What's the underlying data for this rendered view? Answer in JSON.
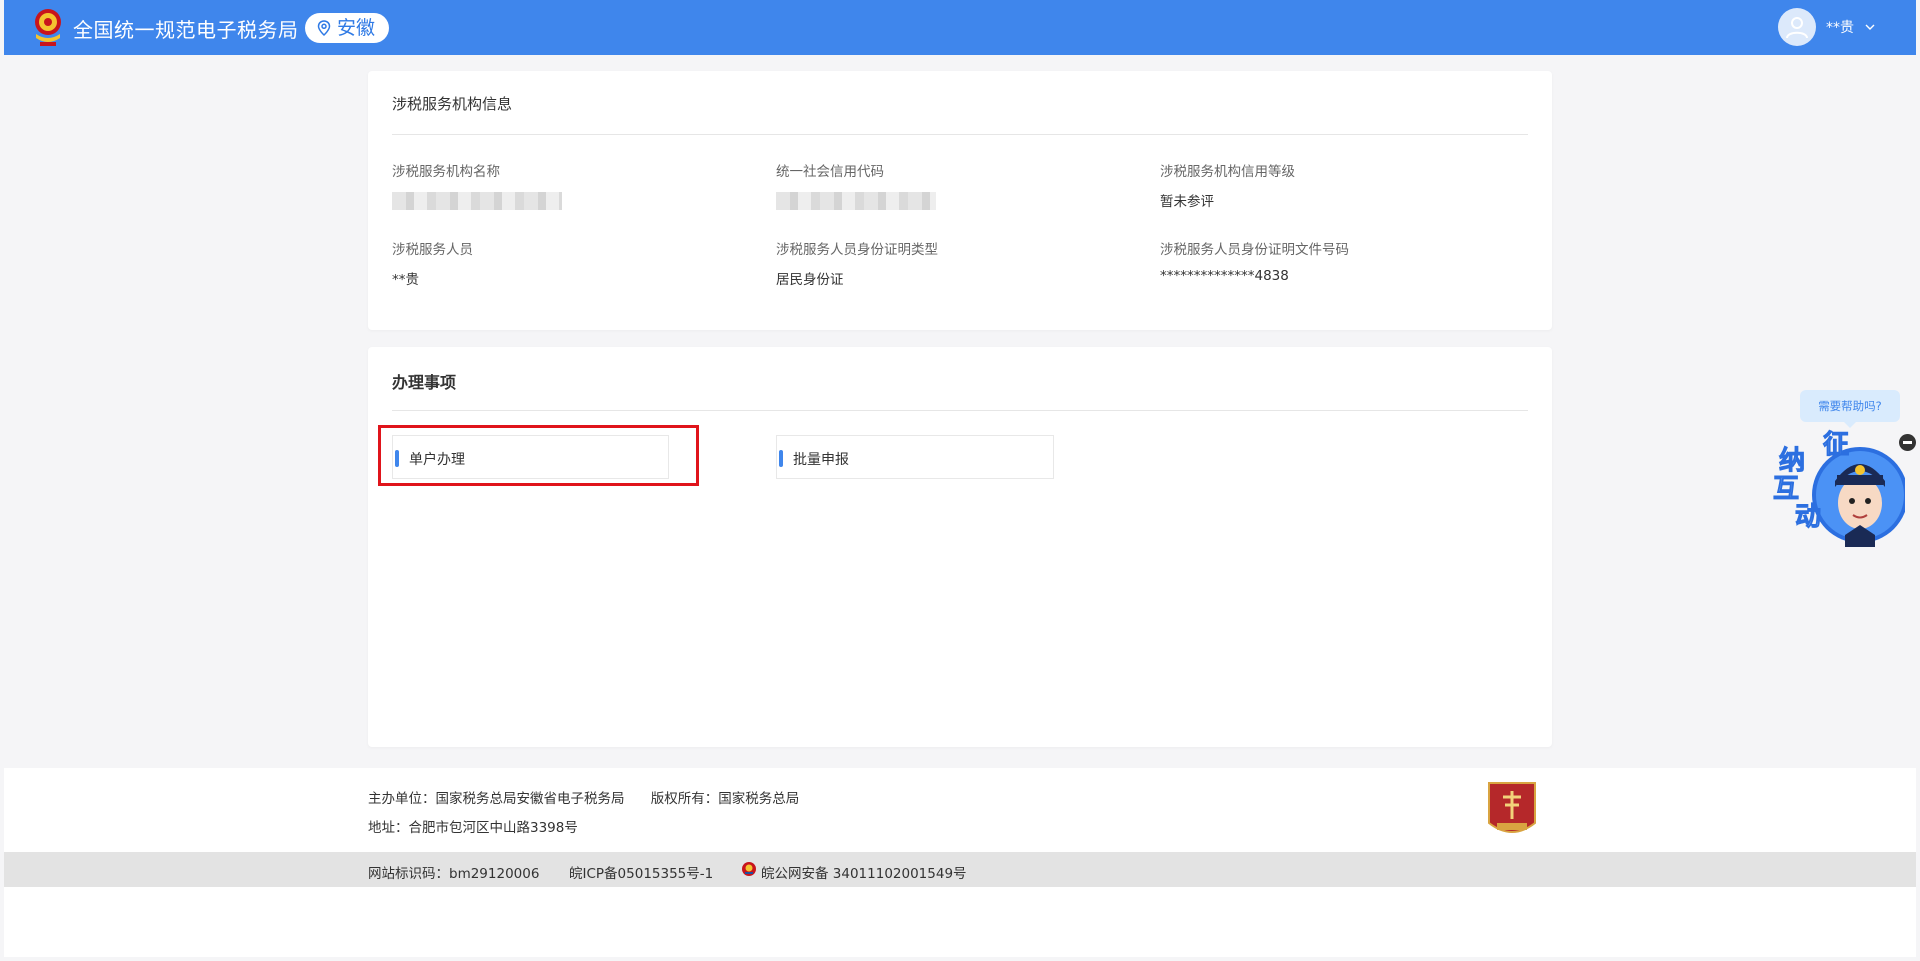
{
  "header": {
    "site_title": "全国统一规范电子税务局",
    "region": "安徽",
    "user_name": "**贵"
  },
  "info_card": {
    "title": "涉税服务机构信息",
    "fields": [
      {
        "label": "涉税服务机构名称",
        "value": ""
      },
      {
        "label": "统一社会信用代码",
        "value": ""
      },
      {
        "label": "涉税服务机构信用等级",
        "value": "暂未参评"
      },
      {
        "label": "涉税服务人员",
        "value": "**贵"
      },
      {
        "label": "涉税服务人员身份证明类型",
        "value": "居民身份证"
      },
      {
        "label": "涉税服务人员身份证明文件号码",
        "value": "**************4838"
      }
    ]
  },
  "tasks_card": {
    "title": "办理事项",
    "buttons": [
      {
        "label": "单户办理"
      },
      {
        "label": "批量申报"
      }
    ]
  },
  "footer": {
    "sponsor": "主办单位：国家税务总局安徽省电子税务局",
    "copyright": "版权所有：国家税务总局",
    "address": "地址：合肥市包河区中山路3398号",
    "site_code": "网站标识码：bm29120006",
    "icp": "皖ICP备05015355号-1",
    "police_record": "皖公网安备 34011102001549号"
  },
  "helper": {
    "bubble": "需要帮助吗?",
    "chars": [
      "征",
      "纳",
      "互",
      "动"
    ]
  },
  "colors": {
    "header_blue": "#3f86ec",
    "highlight_red": "#e0141b"
  }
}
